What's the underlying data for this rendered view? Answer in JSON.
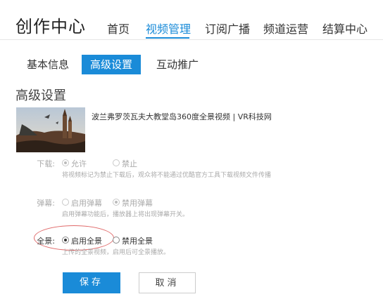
{
  "header": {
    "app_title": "创作中心",
    "nav": [
      {
        "label": "首页"
      },
      {
        "label": "视频管理"
      },
      {
        "label": "订阅广播"
      },
      {
        "label": "频道运营"
      },
      {
        "label": "结算中心"
      }
    ],
    "active_nav": "视频管理"
  },
  "sub_tabs": [
    {
      "label": "基本信息"
    },
    {
      "label": "高级设置"
    },
    {
      "label": "互动推广"
    }
  ],
  "active_sub_tab": "高级设置",
  "section_title": "高级设置",
  "video": {
    "title": "波兰弗罗茨瓦夫大教堂岛360度全景视频 | VR科技网"
  },
  "settings": {
    "download": {
      "label": "下载:",
      "options": [
        "允许",
        "禁止"
      ],
      "selected": "允许",
      "hint": "将视频标记为禁止下载后，观众将不能通过优酷官方工具下载视频文件传播"
    },
    "danmaku": {
      "label": "弹幕:",
      "options": [
        "启用弹幕",
        "禁用弹幕"
      ],
      "selected": "禁用弹幕",
      "hint": "启用弹幕功能后，播放器上将出现弹幕开关。"
    },
    "panorama": {
      "label": "全景:",
      "options": [
        "启用全景",
        "禁用全景"
      ],
      "selected": "启用全景",
      "hint": "上传的全景视频，启用后可全景播放。"
    }
  },
  "buttons": {
    "save": "保存",
    "cancel": "取消"
  },
  "colors": {
    "accent": "#1a8bd8",
    "highlight_ellipse": "#e06a6a"
  }
}
